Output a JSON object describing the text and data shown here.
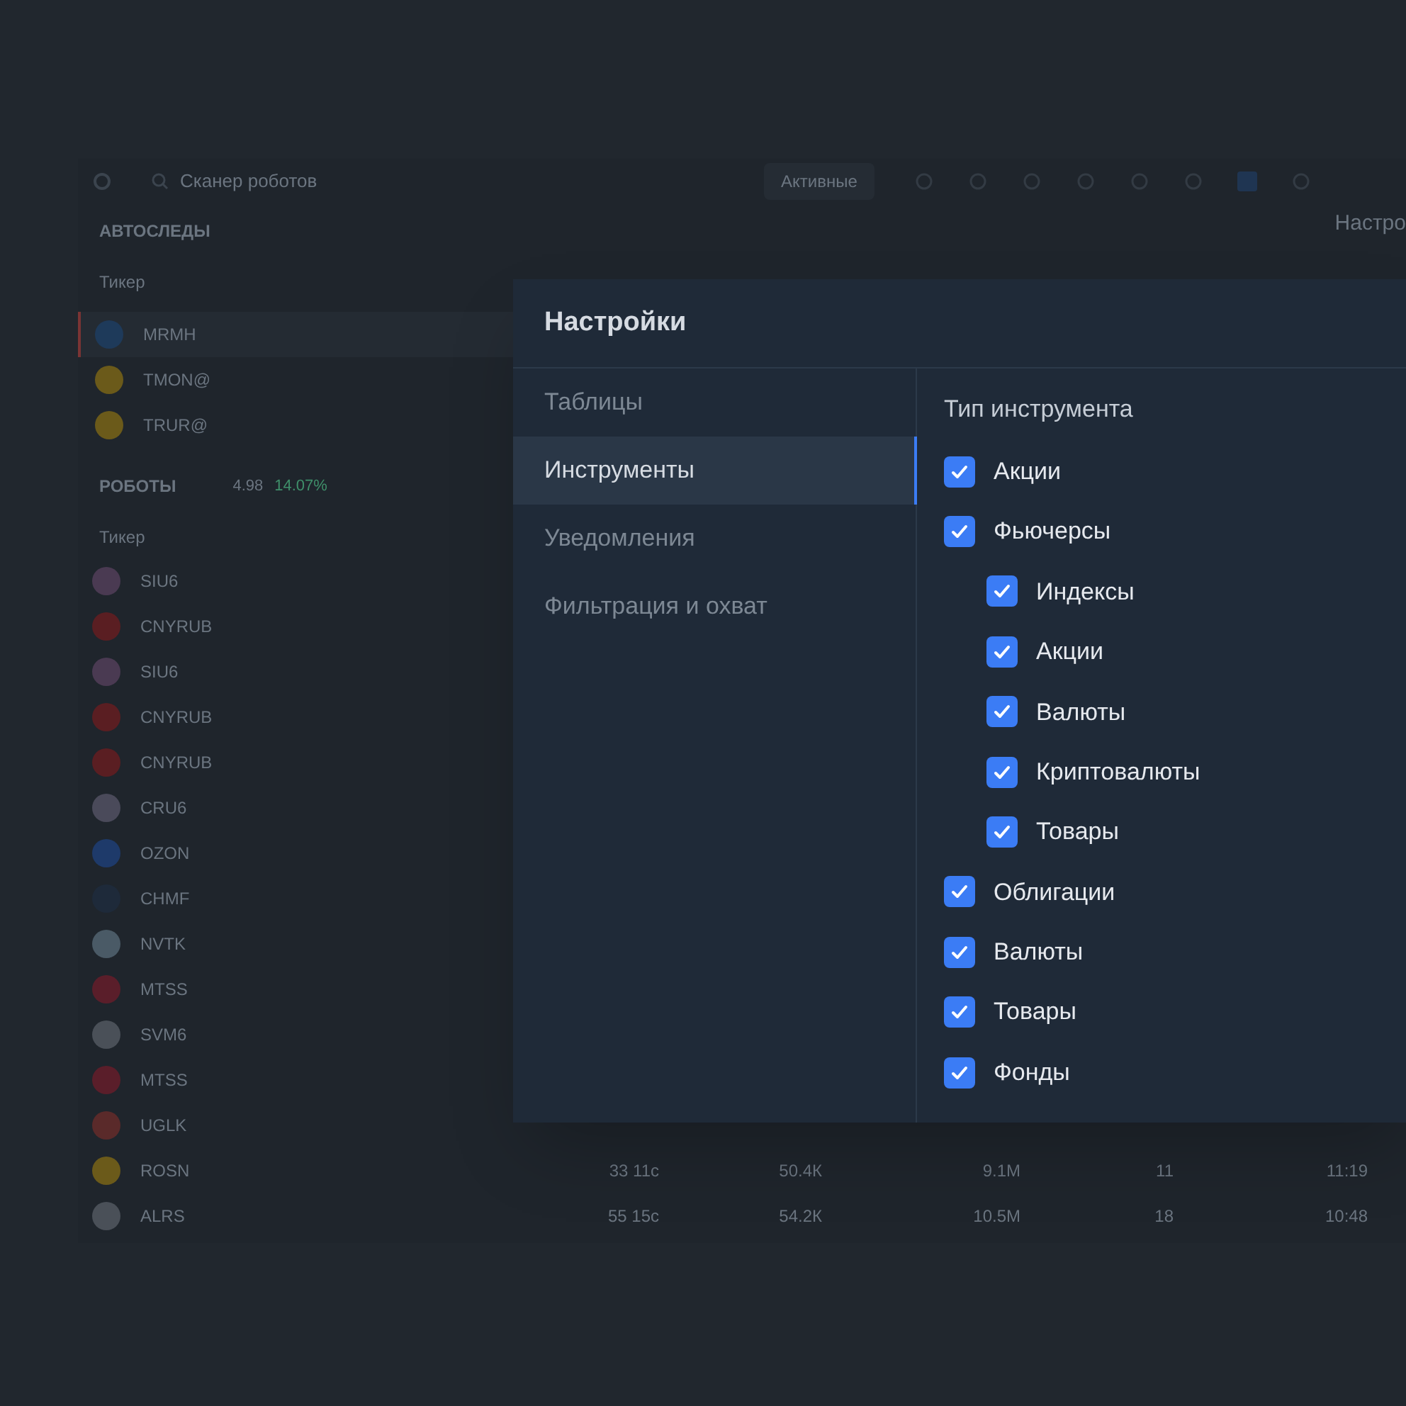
{
  "toolbar": {
    "search": {
      "placeholder": "Сканер роботов"
    },
    "filter_button": "Активные",
    "side_title": "Настро"
  },
  "autoslede": {
    "title": "АВТОСЛЕДЫ",
    "column": "Тикер",
    "rows": [
      {
        "ticker": "MRMH",
        "color": "#1e3a5a",
        "selected": true
      },
      {
        "ticker": "TMON@",
        "color": "#6b5a1a",
        "selected": false
      },
      {
        "ticker": "TRUR@",
        "color": "#6b5a1a",
        "selected": false
      }
    ]
  },
  "robots": {
    "title": "РОБОТЫ",
    "count": "4.98",
    "change": "14.07%",
    "column": "Тикер",
    "rows": [
      {
        "ticker": "SIU6",
        "color": "#4a3a52",
        "cells": []
      },
      {
        "ticker": "CNYRUB",
        "color": "#5a1e22",
        "cells": []
      },
      {
        "ticker": "SIU6",
        "color": "#4a3a52",
        "cells": []
      },
      {
        "ticker": "CNYRUB",
        "color": "#5a1e22",
        "cells": []
      },
      {
        "ticker": "CNYRUB",
        "color": "#5a1e22",
        "cells": []
      },
      {
        "ticker": "CRU6",
        "color": "#4a4a5a",
        "cells": []
      },
      {
        "ticker": "OZON",
        "color": "#1e3a6a",
        "cells": []
      },
      {
        "ticker": "CHMF",
        "color": "#1e2a3a",
        "cells": []
      },
      {
        "ticker": "NVTK",
        "color": "#4a5a66",
        "cells": []
      },
      {
        "ticker": "MTSS",
        "color": "#5a1e2a",
        "cells": []
      },
      {
        "ticker": "SVM6",
        "color": "#4a5058",
        "cells": []
      },
      {
        "ticker": "MTSS",
        "color": "#5a1e2a",
        "cells": []
      },
      {
        "ticker": "UGLK",
        "color": "#5a2a2a",
        "cells": []
      },
      {
        "ticker": "ROSN",
        "color": "#6b5a1a",
        "cells": [
          "33 11с",
          "50.4К",
          "9.1М",
          "11",
          "11:19"
        ]
      },
      {
        "ticker": "ALRS",
        "color": "#4a5058",
        "cells": [
          "55 15с",
          "54.2К",
          "10.5М",
          "18",
          "10:48"
        ]
      }
    ]
  },
  "dialog": {
    "title": "Настройки",
    "nav": [
      {
        "label": "Таблицы",
        "selected": false
      },
      {
        "label": "Инструменты",
        "selected": true
      },
      {
        "label": "Уведомления",
        "selected": false
      },
      {
        "label": "Фильтрация и охват",
        "selected": false
      }
    ],
    "section_title": "Тип инструмента",
    "options": [
      {
        "label": "Акции",
        "checked": true
      },
      {
        "label": "Фьючерсы",
        "checked": true,
        "children": [
          {
            "label": "Индексы",
            "checked": true
          },
          {
            "label": "Акции",
            "checked": true
          },
          {
            "label": "Валюты",
            "checked": true
          },
          {
            "label": "Криптовалюты",
            "checked": true
          },
          {
            "label": "Товары",
            "checked": true
          }
        ]
      },
      {
        "label": "Облигации",
        "checked": true
      },
      {
        "label": "Валюты",
        "checked": true
      },
      {
        "label": "Товары",
        "checked": true
      },
      {
        "label": "Фонды",
        "checked": true
      }
    ]
  }
}
